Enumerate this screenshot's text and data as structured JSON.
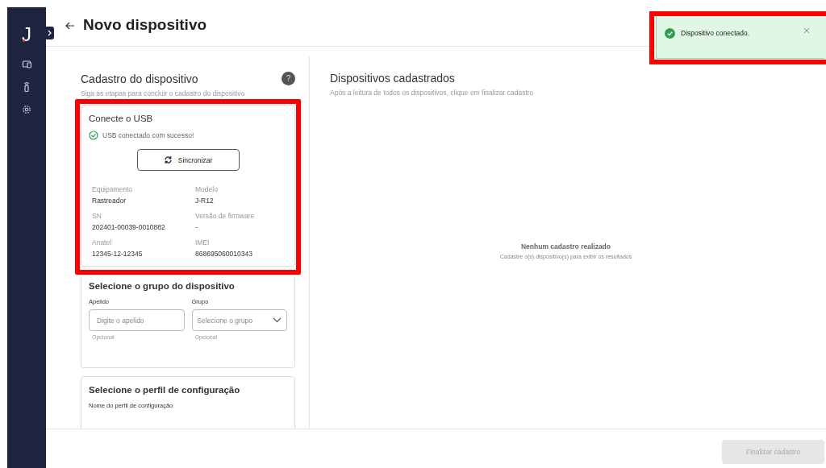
{
  "sidebar": {
    "logo": "J",
    "items": [
      {
        "kind": "devices"
      },
      {
        "kind": "tracker"
      },
      {
        "kind": "settings"
      }
    ]
  },
  "header": {
    "title": "Novo dispositivo"
  },
  "toast": {
    "message": "Dispositivo conectado.",
    "highlighted": true
  },
  "registration": {
    "title": "Cadastro do dispositivo",
    "subtitle": "Siga as etapas para concluir o cadastro do dispositivo",
    "help": "?",
    "usb_card": {
      "title": "Conecte o USB",
      "status": "USB conectado com sucesso!",
      "connected": true,
      "sync_button": "Sincronizar",
      "highlighted": true,
      "fields": [
        {
          "label": "Equipamento",
          "value": "Rastreador"
        },
        {
          "label": "Modelo",
          "value": "J-R12"
        },
        {
          "label": "SN",
          "value": "202401-00039-0010882"
        },
        {
          "label": "Versão de firmware",
          "value": "-"
        },
        {
          "label": "Anatel",
          "value": "12345-12-12345"
        },
        {
          "label": "IMEI",
          "value": "868695060010343"
        }
      ]
    },
    "group_card": {
      "title": "Selecione o grupo do dispositivo",
      "fields": [
        {
          "kind": "text",
          "label": "Apelido",
          "placeholder": "Digite o apelido",
          "hint": "Opcional"
        },
        {
          "kind": "select",
          "label": "Grupo",
          "placeholder": "Selecione o grupo",
          "hint": "Opcional"
        }
      ]
    },
    "profile_card": {
      "title": "Selecione o perfil de configuração",
      "field_label": "Nome do perfil de configuração"
    }
  },
  "registered": {
    "title": "Dispositivos cadastrados",
    "subtitle": "Após a leitura de todos os dispositivos, clique em finalizar cadastro",
    "empty_title": "Nenhum cadastro realizado",
    "empty_text": "Cadastre o(s) dispositivo(s) para exibir os resultados"
  },
  "footer": {
    "finish_button": {
      "label": "Finalizar cadastro",
      "disabled": true
    }
  }
}
